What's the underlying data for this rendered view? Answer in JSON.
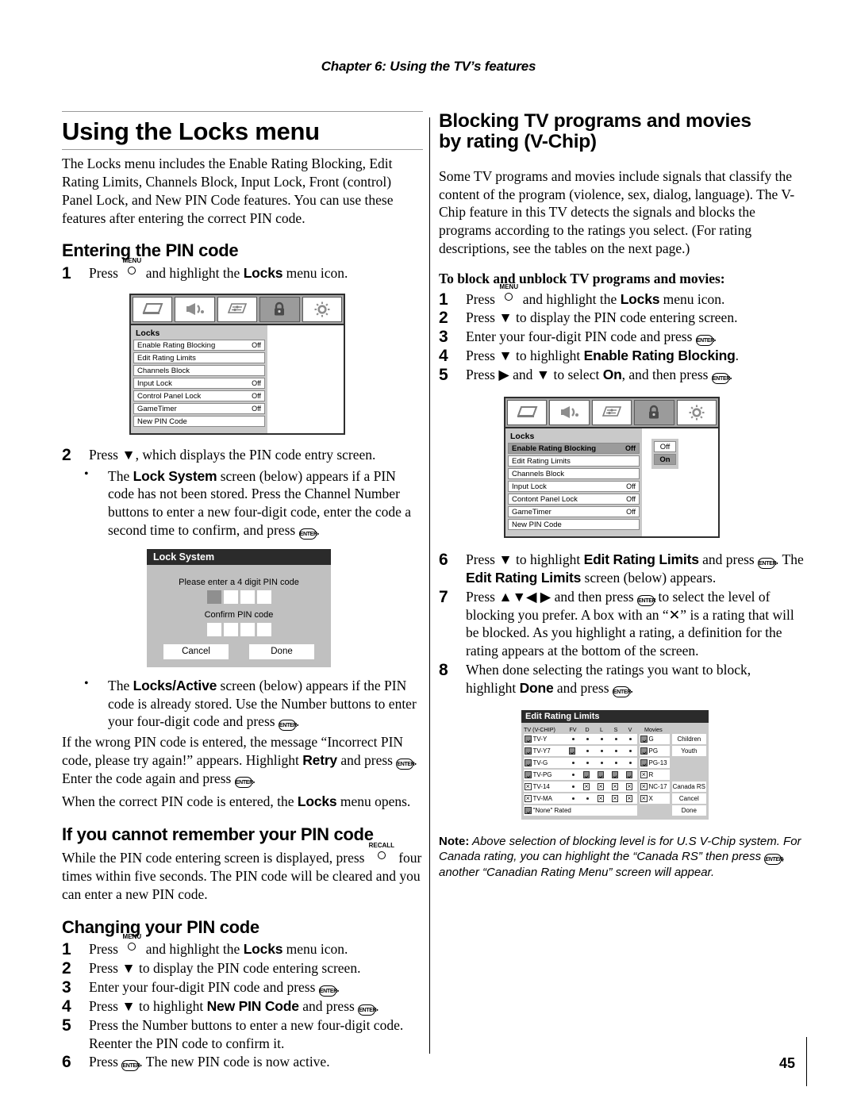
{
  "header": {
    "chapter": "Chapter 6: Using the TV’s features"
  },
  "page_number": "45",
  "left": {
    "title": "Using the Locks menu",
    "intro": "The Locks menu includes the Enable Rating Blocking, Edit Rating Limits, Channels Block, Input Lock, Front (control) Panel Lock, and New PIN Code features. You can use these features after entering the correct PIN code.",
    "section_pin": "Entering the PIN code",
    "step1_pre": "Press ",
    "step1_mid": " and highlight the ",
    "step1_bold": "Locks",
    "step1_post": " menu icon.",
    "step2": "Press ▼, which displays the PIN code entry screen.",
    "bullet1_pre": "The ",
    "bullet1_bold": "Lock System",
    "bullet1_post": " screen (below) appears if a PIN code has not been stored. Press the Channel Number buttons to enter a new four-digit code, enter the code a second time to confirm, and press ",
    "bullet2_pre": "The ",
    "bullet2_bold": "Locks/Active",
    "bullet2_post": " screen (below) appears if the PIN code is already stored. Use the Number buttons to enter your four-digit code and press ",
    "para_wrong_a": "If the wrong PIN code is entered, the message “Incorrect PIN code, please try again!” appears. Highlight ",
    "para_wrong_bold": "Retry",
    "para_wrong_b": " and press ",
    "para_wrong_c": ". Enter the code again and press ",
    "para_correct_a": "When the correct PIN code is entered, the ",
    "para_correct_bold": "Locks",
    "para_correct_b": " menu opens.",
    "section_forgot": "If you cannot remember your PIN code",
    "forgot_a": "While the PIN code entering screen is displayed, press ",
    "forgot_b": " four times within five seconds. The PIN code will be cleared and you can enter a new PIN code.",
    "section_change": "Changing your PIN code",
    "chg2": "Press ▼ to display the PIN code entering screen.",
    "chg3_a": "Enter your four-digit PIN code and press ",
    "chg3_b": ".",
    "chg4_a": "Press ▼ to highlight ",
    "chg4_bold": "New PIN Code",
    "chg4_b": " and press ",
    "chg4_c": ".",
    "chg5": "Press the Number buttons to enter a new four-digit code. Reenter the PIN code to confirm it.",
    "chg6_a": "Press ",
    "chg6_b": ". The new PIN code is now active."
  },
  "right": {
    "title_line1": "Blocking TV programs and movies",
    "title_line2": "by rating (V-Chip)",
    "intro": "Some TV programs and movies include signals that classify the content of the program (violence, sex, dialog, language). The V-Chip feature in this TV detects the signals and blocks the programs according to the ratings you select. (For rating descriptions, see the tables on the next page.)",
    "subhead": "To block and unblock TV programs and movies:",
    "s1_a": "Press ",
    "s1_b": " and highlight the ",
    "s1_bold": "Locks",
    "s1_c": " menu icon.",
    "s2": "Press ▼ to display the PIN code entering screen.",
    "s3_a": "Enter your four-digit PIN code and press ",
    "s3_b": ".",
    "s4_a": "Press ▼ to highlight ",
    "s4_bold": "Enable Rating Blocking",
    "s4_b": ".",
    "s5_a": "Press ▶ and ▼ to select ",
    "s5_bold": "On",
    "s5_b": ", and then press ",
    "s5_c": ".",
    "s6_a": "Press ▼ to highlight ",
    "s6_bold1": "Edit Rating Limits",
    "s6_b": " and press ",
    "s6_c": ". The ",
    "s6_bold2": "Edit Rating Limits",
    "s6_d": " screen (below) appears.",
    "s7_a": "Press ▲▼◀ ▶ and then press ",
    "s7_b": " to select the level of blocking you prefer. A box with an “✕” is a rating that will be blocked. As you highlight a rating, a definition for the rating appears at the bottom of the screen.",
    "s8_a": "When done selecting the ratings you want to block, highlight ",
    "s8_bold": "Done",
    "s8_b": " and press ",
    "s8_c": ".",
    "note_label": "Note:",
    "note_text": " Above selection of blocking level is for U.S V-Chip system. For Canada rating, you can highlight the “Canada RS” then press ",
    "note_text2": ", another “Canadian Rating Menu” screen will appear."
  },
  "osd_locks": {
    "icons": [
      "picture-icon",
      "audio-icon",
      "settings-icon",
      "lock-icon",
      "setup-icon"
    ],
    "active_icon_index": 3,
    "panel_title": "Locks",
    "rows": [
      {
        "label": "Enable Rating Blocking",
        "value": "Off"
      },
      {
        "label": "Edit Rating Limits",
        "value": ""
      },
      {
        "label": "Channels Block",
        "value": ""
      },
      {
        "label": "Input Lock",
        "value": "Off"
      },
      {
        "label": "Control Panel Lock",
        "value": "Off"
      },
      {
        "label": "GameTimer",
        "value": "Off"
      },
      {
        "label": "New PIN Code",
        "value": ""
      }
    ]
  },
  "osd_locks_on": {
    "panel_title": "Locks",
    "rows": [
      {
        "label": "Enable Rating Blocking",
        "value": "Off",
        "selected": true
      },
      {
        "label": "Edit Rating Limits",
        "value": ""
      },
      {
        "label": "Channels Block",
        "value": ""
      },
      {
        "label": "Input Lock",
        "value": "Off"
      },
      {
        "label": "Contont Panel Lock",
        "value": "Off"
      },
      {
        "label": "GameTimer",
        "value": "Off"
      },
      {
        "label": "New PIN Code",
        "value": ""
      }
    ],
    "options": [
      {
        "label": "Off",
        "selected": false
      },
      {
        "label": "On",
        "selected": true
      }
    ]
  },
  "lock_system": {
    "title": "Lock System",
    "prompt1": "Please enter a 4 digit PIN code",
    "prompt2": "Confirm PIN code",
    "pin_boxes": [
      "filled",
      "empty",
      "empty",
      "empty"
    ],
    "confirm_boxes": [
      "empty",
      "empty",
      "empty",
      "empty"
    ],
    "cancel": "Cancel",
    "done": "Done"
  },
  "edit_rating_limits": {
    "title": "Edit Rating Limits",
    "tv_header": "TV (V-CHIP)",
    "columns": [
      "FV",
      "D",
      "L",
      "S",
      "V"
    ],
    "movies_header": "Movies",
    "tv_rows": [
      {
        "name": "TV-Y",
        "state": "chk",
        "cells": [
          "dot",
          "dot",
          "dot",
          "dot",
          "dot"
        ]
      },
      {
        "name": "TV-Y7",
        "state": "chk",
        "cells": [
          "chk",
          "dot",
          "dot",
          "dot",
          "dot"
        ]
      },
      {
        "name": "TV-G",
        "state": "chk",
        "cells": [
          "dot",
          "dot",
          "dot",
          "dot",
          "dot"
        ]
      },
      {
        "name": "TV-PG",
        "state": "chk",
        "cells": [
          "dot",
          "chk",
          "chk",
          "chk",
          "chk"
        ]
      },
      {
        "name": "TV-14",
        "state": "xx",
        "cells": [
          "dot",
          "xx",
          "xx",
          "xx",
          "xx"
        ]
      },
      {
        "name": "TV-MA",
        "state": "xx",
        "cells": [
          "dot",
          "dot",
          "xx",
          "xx",
          "xx"
        ]
      }
    ],
    "none_rated": {
      "name": "\"None\" Rated",
      "state": "chk"
    },
    "movie_rows": [
      {
        "name": "G",
        "state": "chk"
      },
      {
        "name": "PG",
        "state": "chk"
      },
      {
        "name": "PG-13",
        "state": "chk"
      },
      {
        "name": "R",
        "state": "xx"
      },
      {
        "name": "NC-17",
        "state": "xx"
      },
      {
        "name": "X",
        "state": "xx"
      }
    ],
    "buttons": [
      "Children",
      "Youth",
      "",
      "",
      "Canada RS",
      "Cancel",
      "Done"
    ]
  }
}
